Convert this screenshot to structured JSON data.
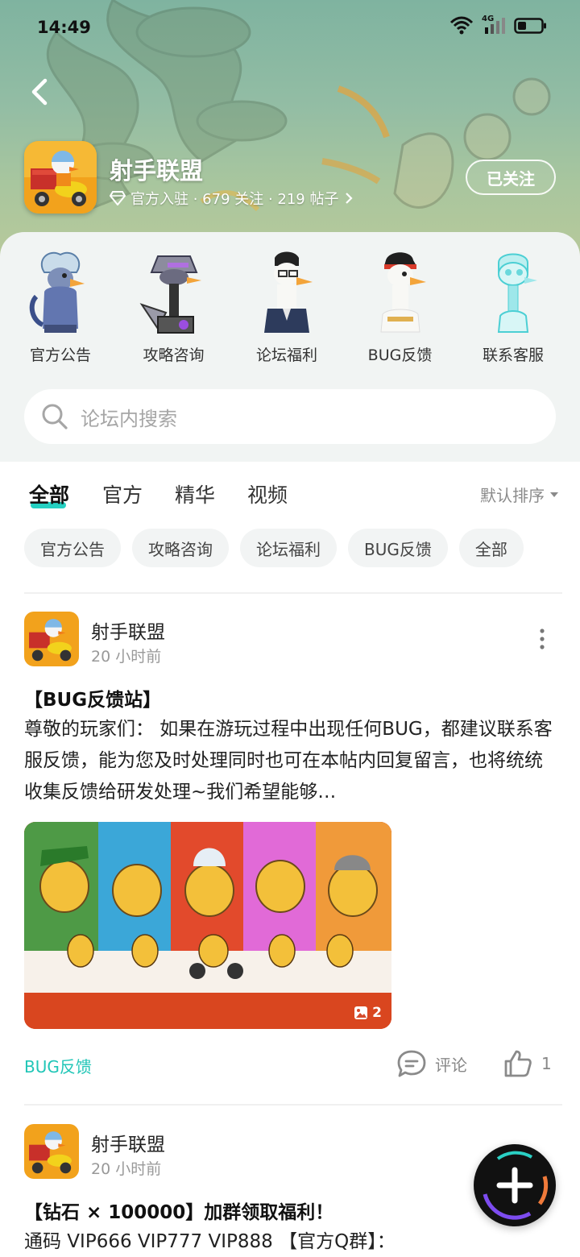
{
  "status_bar": {
    "time": "14:49",
    "network": "4G"
  },
  "game": {
    "name": "射手联盟",
    "meta": "官方入驻 · 679 关注 · 219 帖子",
    "follow_label": "已关注"
  },
  "categories": [
    {
      "label": "官方公告",
      "icon": "official-announcement-icon"
    },
    {
      "label": "攻略咨询",
      "icon": "guide-consult-icon"
    },
    {
      "label": "论坛福利",
      "icon": "forum-welfare-icon"
    },
    {
      "label": "BUG反馈",
      "icon": "bug-feedback-icon"
    },
    {
      "label": "联系客服",
      "icon": "customer-service-icon"
    }
  ],
  "search": {
    "placeholder": "论坛内搜索"
  },
  "tabs": [
    {
      "label": "全部",
      "active": true
    },
    {
      "label": "官方",
      "active": false
    },
    {
      "label": "精华",
      "active": false
    },
    {
      "label": "视频",
      "active": false
    }
  ],
  "sort_label": "默认排序",
  "chips": [
    "官方公告",
    "攻略咨询",
    "论坛福利",
    "BUG反馈",
    "全部"
  ],
  "posts": [
    {
      "author": "射手联盟",
      "time": "20 小时前",
      "title": "【BUG反馈站】",
      "body": "尊敬的玩家们：  如果在游玩过程中出现任何BUG，都建议联系客服反馈，能为您及时处理同时也可在本帖内回复留言，也将统统收集反馈给研发处理~我们希望能够…",
      "image_count": "2",
      "tag": "BUG反馈",
      "comment_label": "评论",
      "like_count": "1"
    },
    {
      "author": "射手联盟",
      "time": "20 小时前",
      "title": "【钻石 × 100000】加群领取福利！",
      "body": "通码 VIP666 VIP777 VIP888 【官方Q群】："
    }
  ],
  "colors": {
    "accent": "#25d0c2",
    "tag": "#21c6b7"
  }
}
